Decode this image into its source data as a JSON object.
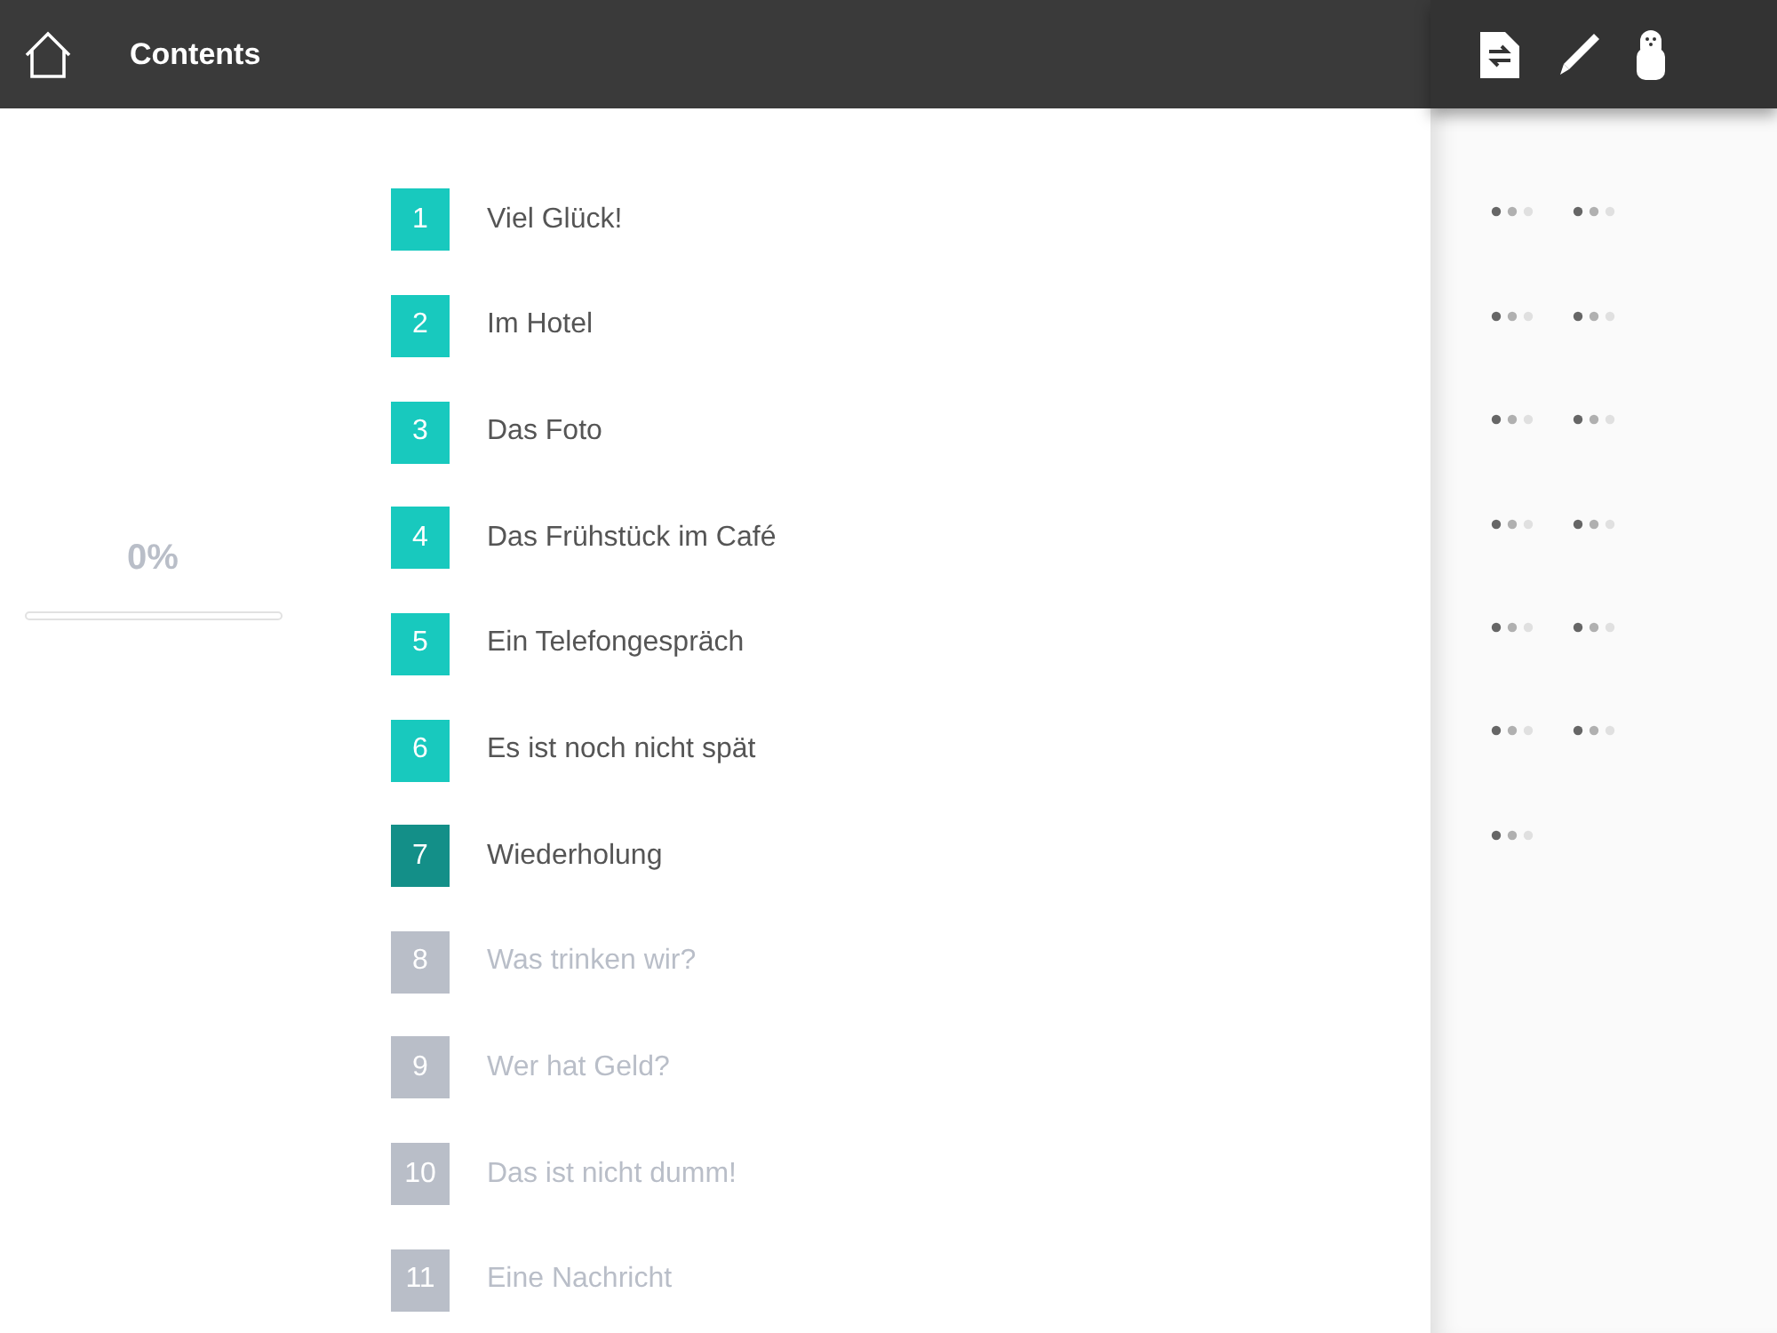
{
  "header": {
    "title": "Contents"
  },
  "progress": {
    "reading": "0%",
    "level": 0
  },
  "lessons": [
    {
      "number": "1",
      "title": "Viel Glück!",
      "selected": false,
      "locked": false,
      "exercises": true,
      "test": true
    },
    {
      "number": "2",
      "title": "Im Hotel",
      "selected": false,
      "locked": false,
      "exercises": true,
      "test": true
    },
    {
      "number": "3",
      "title": "Das Foto",
      "selected": false,
      "locked": false,
      "exercises": true,
      "test": true
    },
    {
      "number": "4",
      "title": "Das Frühstück im Café",
      "selected": false,
      "locked": false,
      "exercises": true,
      "test": true
    },
    {
      "number": "5",
      "title": "Ein Telefongespräch",
      "selected": false,
      "locked": false,
      "exercises": true,
      "test": true
    },
    {
      "number": "6",
      "title": "Es ist noch nicht spät",
      "selected": false,
      "locked": false,
      "exercises": true,
      "test": true
    },
    {
      "number": "7",
      "title": "Wiederholung",
      "selected": true,
      "locked": false,
      "exercises": true,
      "test": false
    },
    {
      "number": "8",
      "title": "Was trinken wir?",
      "selected": false,
      "locked": true,
      "exercises": false,
      "test": false
    },
    {
      "number": "9",
      "title": "Wer hat Geld?",
      "selected": false,
      "locked": true,
      "exercises": false,
      "test": false
    },
    {
      "number": "10",
      "title": "Das ist nicht dumm!",
      "selected": false,
      "locked": true,
      "exercises": false,
      "test": false
    },
    {
      "number": "11",
      "title": "Eine Nachricht",
      "selected": false,
      "locked": true,
      "exercises": false,
      "test": false
    }
  ]
}
